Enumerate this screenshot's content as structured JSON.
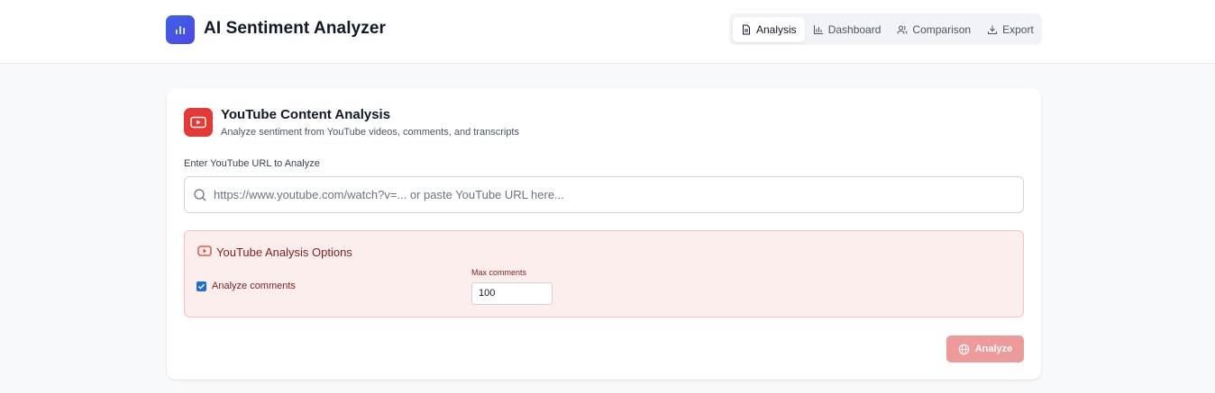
{
  "header": {
    "app_title": "AI Sentiment Analyzer",
    "logo_icon": "bar-chart-icon",
    "nav": [
      {
        "label": "Analysis",
        "icon": "document-icon",
        "active": true
      },
      {
        "label": "Dashboard",
        "icon": "bar-chart-icon",
        "active": false
      },
      {
        "label": "Comparison",
        "icon": "users-icon",
        "active": false
      },
      {
        "label": "Export",
        "icon": "download-icon",
        "active": false
      }
    ]
  },
  "card": {
    "icon": "youtube-icon",
    "title": "YouTube Content Analysis",
    "subtitle": "Analyze sentiment from YouTube videos, comments, and transcripts",
    "url_label": "Enter YouTube URL to Analyze",
    "url_placeholder": "https://www.youtube.com/watch?v=... or paste YouTube URL here...",
    "url_value": "",
    "options": {
      "title": "YouTube Analysis Options",
      "analyze_comments_label": "Analyze comments",
      "analyze_comments_checked": true,
      "max_comments_label": "Max comments",
      "max_comments_value": "100"
    },
    "analyze_button": "Analyze"
  },
  "colors": {
    "brand": "#3b63e6",
    "youtube_red": "#e53935",
    "options_bg": "#fdeeee",
    "analyze_button_bg": "#ef9a9a"
  }
}
